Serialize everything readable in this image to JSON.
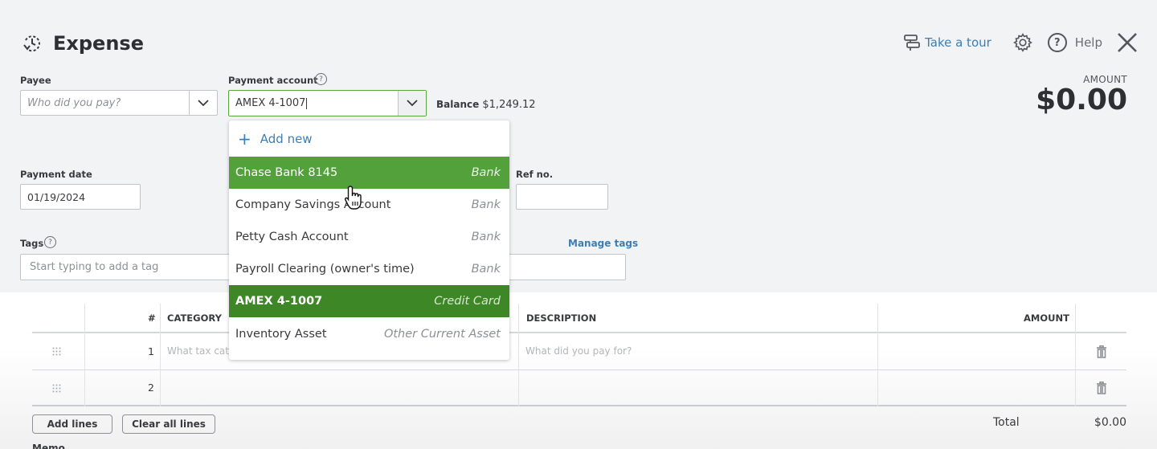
{
  "header": {
    "title": "Expense",
    "take_tour": "Take a tour",
    "help": "Help",
    "amount_label": "AMOUNT",
    "amount_value": "$0.00"
  },
  "form": {
    "payee": {
      "label": "Payee",
      "placeholder": "Who did you pay?"
    },
    "payment_account": {
      "label": "Payment account",
      "value": "AMEX 4-1007"
    },
    "balance": {
      "label": "Balance",
      "value": "$1,249.12"
    },
    "payment_date": {
      "label": "Payment date",
      "value": "01/19/2024"
    },
    "ref_no": {
      "label": "Ref no.",
      "value": ""
    },
    "tags": {
      "label": "Tags",
      "placeholder": "Start typing to add a tag",
      "manage": "Manage tags"
    }
  },
  "dropdown": {
    "add_new": "Add new",
    "items": [
      {
        "name": "Chase Bank 8145",
        "type": "Bank",
        "state": "hover"
      },
      {
        "name": "Company Savings Account",
        "type": "Bank",
        "state": ""
      },
      {
        "name": "Petty Cash Account",
        "type": "Bank",
        "state": ""
      },
      {
        "name": "Payroll Clearing (owner's time)",
        "type": "Bank",
        "state": ""
      },
      {
        "name": "AMEX 4-1007",
        "type": "Credit Card",
        "state": "selected"
      },
      {
        "name": "Inventory Asset",
        "type": "Other Current Asset",
        "state": ""
      }
    ]
  },
  "table": {
    "headers": {
      "num": "#",
      "category": "CATEGORY",
      "description": "DESCRIPTION",
      "amount": "AMOUNT"
    },
    "rows": [
      {
        "num": "1",
        "category_placeholder": "What tax cate",
        "description_placeholder": "What did you pay for?"
      },
      {
        "num": "2",
        "category_placeholder": "",
        "description_placeholder": ""
      }
    ]
  },
  "footer": {
    "add_lines": "Add lines",
    "clear_all": "Clear all lines",
    "total_label": "Total",
    "total_value": "$0.00",
    "memo_label": "Memo"
  },
  "colors": {
    "hover_green": "#53a13b",
    "selected_green": "#3e8727",
    "link_blue": "#3b7fb6"
  }
}
